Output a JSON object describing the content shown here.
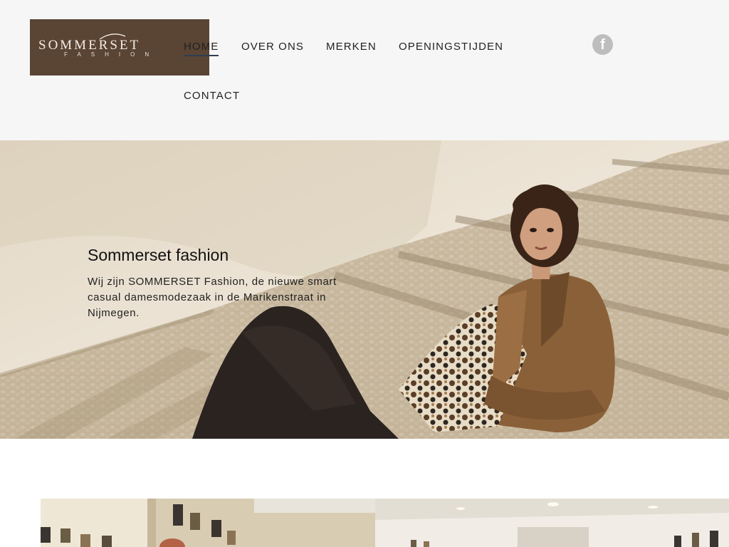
{
  "logo": {
    "main": "SOMMERSET",
    "sub": "FASHION"
  },
  "nav": {
    "items": [
      {
        "label": "HOME"
      },
      {
        "label": "OVER ONS"
      },
      {
        "label": "MERKEN"
      },
      {
        "label": "OPENINGSTIJDEN"
      },
      {
        "label": "CONTACT"
      }
    ],
    "active": "HOME"
  },
  "social": {
    "facebook_icon": "facebook-icon",
    "facebook_glyph": "f"
  },
  "hero": {
    "title": "Sommerset fashion",
    "text": "Wij zijn SOMMERSET Fashion, de nieuwe smart casual damesmodezaak in de Marikenstraat in Nijmegen."
  },
  "colors": {
    "header_bg": "#f6f6f6",
    "logo_bg": "#5a4434",
    "nav_active_underline": "#2f3e52",
    "facebook_icon_bg": "#bdbdbd"
  }
}
